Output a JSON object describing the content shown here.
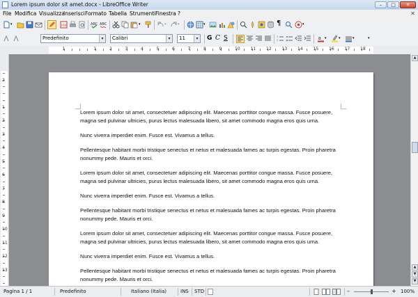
{
  "window": {
    "title": "Lorem ipsum dolor sit amet.docx - LibreOffice Writer"
  },
  "menu": {
    "items": [
      "File",
      "Modifica",
      "Visualizza",
      "Inserisci",
      "Formato",
      "Tabella",
      "Strumenti",
      "Finestra",
      "?"
    ]
  },
  "toolbar": {
    "paragraph_style": "Predefinito",
    "font_name": "Calibri",
    "font_size": "11"
  },
  "ruler": {
    "horizontal_numbers": [
      "1",
      "1",
      "2",
      "3",
      "4",
      "5",
      "6",
      "7",
      "8",
      "9",
      "10",
      "11",
      "12",
      "13",
      "14",
      "15",
      "16",
      "17",
      "18"
    ],
    "vertical_numbers": [
      "1",
      "2",
      "1",
      "2",
      "3",
      "4",
      "5",
      "6",
      "7",
      "8",
      "9",
      "10",
      "11",
      "12",
      "13",
      "14",
      "15"
    ]
  },
  "document": {
    "paragraphs": [
      "Lorem ipsum dolor sit amet, consectetuer adipiscing elit. Maecenas porttitor congue massa. Fusce posuere, magna sed pulvinar ultricies, purus lectus malesuada libero, sit amet commodo magna eros quis urna.",
      "Nunc viverra imperdiet enim. Fusce est. Vivamus a tellus.",
      "Pellentesque habitant morbi tristique senectus et netus et malesuada fames ac turpis egestas. Proin pharetra nonummy pede. Mauris et orci.",
      "Lorem ipsum dolor sit amet, consectetuer adipiscing elit. Maecenas porttitor congue massa. Fusce posuere, magna sed pulvinar ultricies, purus lectus malesuada libero, sit amet commodo magna eros quis urna.",
      "Nunc viverra imperdiet enim. Fusce est. Vivamus a tellus.",
      "Pellentesque habitant morbi tristique senectus et netus et malesuada fames ac turpis egestas. Proin pharetra nonummy pede. Mauris et orci.",
      "Lorem ipsum dolor sit amet, consectetuer adipiscing elit. Maecenas porttitor congue massa. Fusce posuere, magna sed pulvinar ultricies, purus lectus malesuada libero, sit amet commodo magna eros quis urna.",
      "Nunc viverra imperdiet enim. Fusce est. Vivamus a tellus.",
      "Pellentesque habitant morbi tristique senectus et netus et malesuada fames ac turpis egestas. Proin pharetra nonummy pede. Mauris et orci."
    ]
  },
  "status": {
    "page": "Pagina 1 / 1",
    "style": "Predefinito",
    "language": "Italiano (Italia)",
    "insert_mode": "INS",
    "selection_mode": "STD",
    "zoom": "100%"
  },
  "colors": {
    "accent": "#3a6ea5",
    "page_background": "#8b8d90",
    "spell_underline": "#d22020"
  },
  "icons": [
    "new-document-icon",
    "open-icon",
    "save-icon",
    "email-icon",
    "edit-mode-icon",
    "export-pdf-icon",
    "print-icon",
    "print-preview-icon",
    "spellcheck-icon",
    "autospell-icon",
    "cut-icon",
    "copy-icon",
    "paste-icon",
    "clone-format-icon",
    "undo-icon",
    "redo-icon",
    "hyperlink-icon",
    "table-icon",
    "show-draw-functions-icon",
    "find-replace-icon",
    "navigator-icon",
    "gallery-icon",
    "data-sources-icon",
    "nonprinting-characters-icon",
    "zoom-icon",
    "help-icon",
    "bold-icon",
    "italic-icon",
    "underline-icon",
    "align-left-icon",
    "align-center-icon",
    "align-right-icon",
    "justify-icon",
    "numbering-icon",
    "bullets-icon",
    "decrease-indent-icon",
    "increase-indent-icon",
    "font-color-icon",
    "highlight-icon",
    "background-color-icon"
  ]
}
